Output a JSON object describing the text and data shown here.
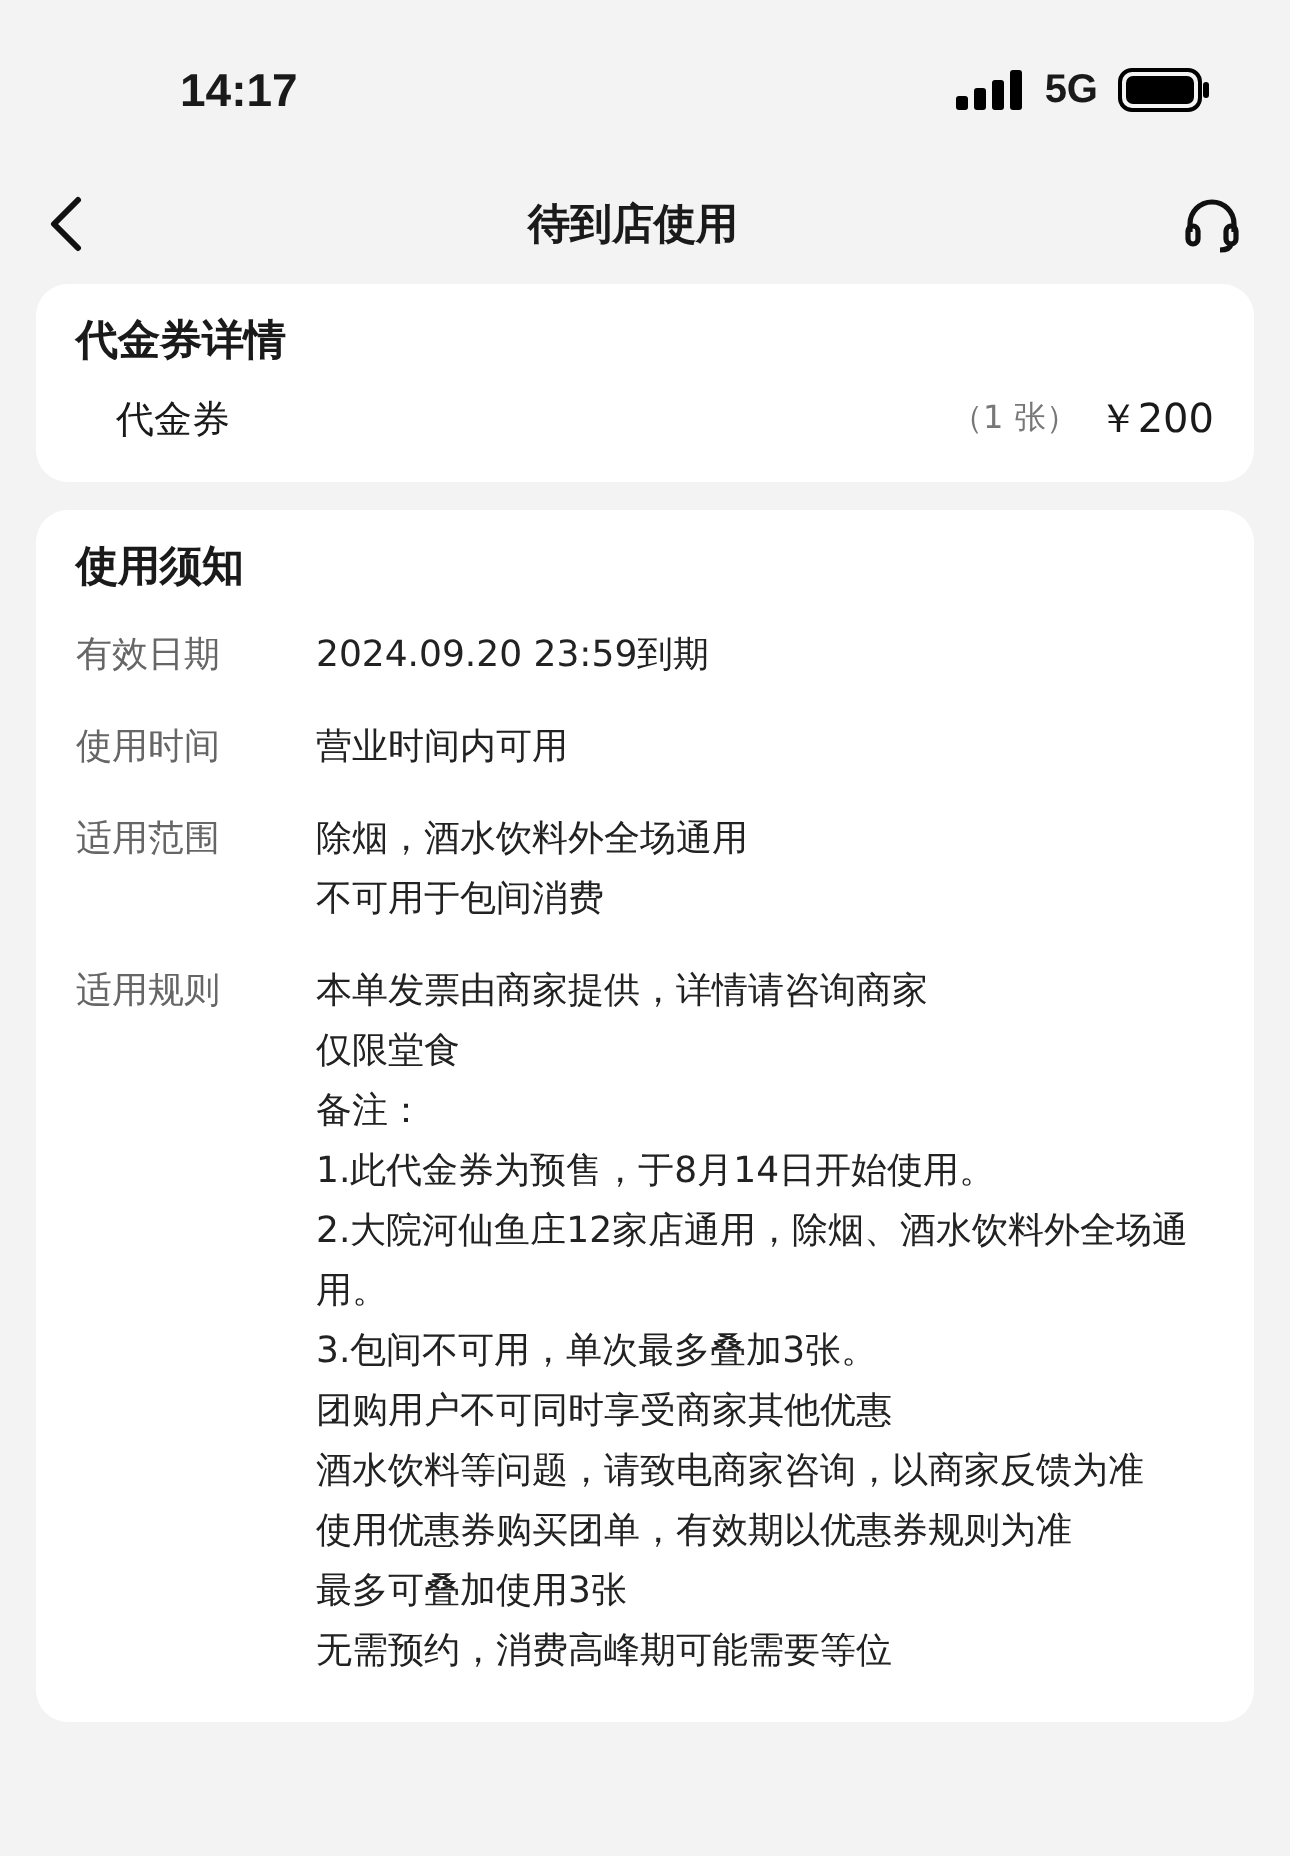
{
  "status_bar": {
    "time": "14:17",
    "network": "5G"
  },
  "nav": {
    "title": "待到店使用"
  },
  "voucher_card": {
    "title": "代金券详情",
    "item": {
      "name": "代金券",
      "count": "（1 张）",
      "price": "￥200"
    }
  },
  "notice_card": {
    "title": "使用须知",
    "rows": [
      {
        "label": "有效日期",
        "lines": [
          "2024.09.20 23:59到期"
        ]
      },
      {
        "label": "使用时间",
        "lines": [
          "营业时间内可用"
        ]
      },
      {
        "label": "适用范围",
        "lines": [
          "除烟，酒水饮料外全场通用",
          "不可用于包间消费"
        ]
      },
      {
        "label": "适用规则",
        "lines": [
          "本单发票由商家提供，详情请咨询商家",
          "仅限堂食",
          "备注：",
          "1.此代金券为预售，于8月14日开始使用。",
          "2.大院河仙鱼庄12家店通用，除烟、酒水饮料外全场通用。",
          "3.包间不可用，单次最多叠加3张。",
          "团购用户不可同时享受商家其他优惠",
          "酒水饮料等问题，请致电商家咨询，以商家反馈为准",
          "使用优惠券购买团单，有效期以优惠券规则为准",
          "最多可叠加使用3张",
          "无需预约，消费高峰期可能需要等位"
        ]
      }
    ]
  }
}
